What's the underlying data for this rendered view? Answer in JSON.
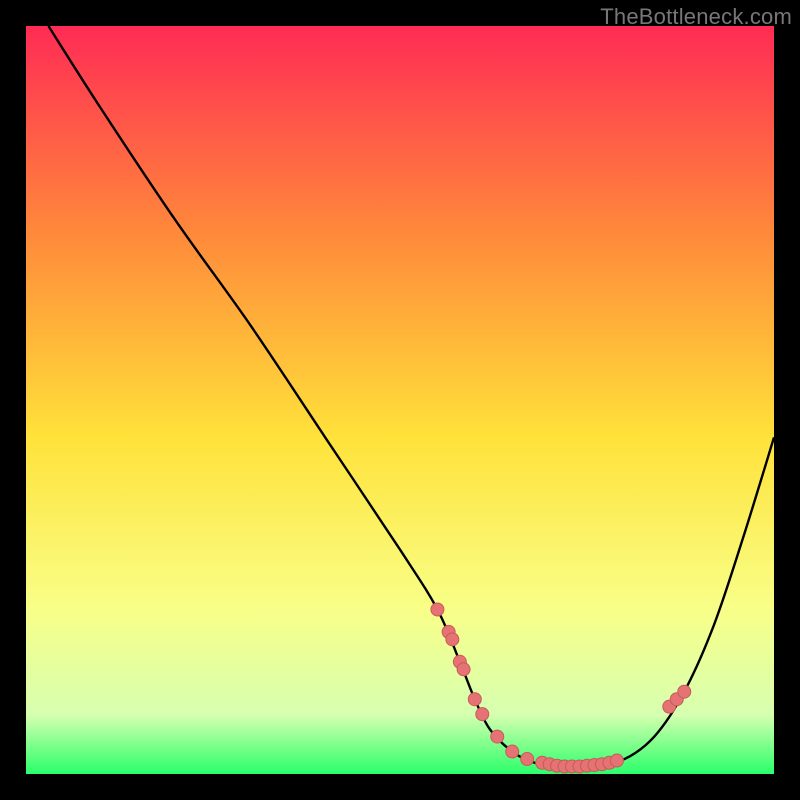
{
  "watermark": "TheBottleneck.com",
  "colors": {
    "gradient_top": "#ff2b55",
    "gradient_mid_upper": "#ff8a3a",
    "gradient_mid": "#ffe23a",
    "gradient_lower": "#f8ff88",
    "gradient_near_bottom": "#d7ffb0",
    "gradient_bottom": "#2aff6a",
    "curve": "#000000",
    "point_fill": "#e57373",
    "point_stroke": "#c85a5a",
    "frame": "#000000"
  },
  "chart_data": {
    "type": "line",
    "title": "",
    "xlabel": "",
    "ylabel": "",
    "xlim": [
      0,
      100
    ],
    "ylim": [
      0,
      100
    ],
    "curve": {
      "name": "bottleneck-curve",
      "x": [
        3,
        10,
        20,
        30,
        40,
        50,
        55,
        58,
        60,
        62,
        65,
        68,
        72,
        76,
        80,
        84,
        88,
        92,
        96,
        100
      ],
      "y": [
        100,
        89,
        74,
        60,
        45,
        30,
        22,
        15,
        10,
        6,
        3,
        1.5,
        1,
        1.2,
        2,
        5,
        11,
        20,
        32,
        45
      ]
    },
    "points": {
      "name": "sample-points",
      "x": [
        55,
        56.5,
        57,
        58,
        58.5,
        60,
        61,
        63,
        65,
        67,
        69,
        70,
        71,
        72,
        73,
        74,
        75,
        76,
        77,
        78,
        79,
        86,
        87,
        88
      ],
      "y": [
        22,
        19,
        18,
        15,
        14,
        10,
        8,
        5,
        3,
        2,
        1.5,
        1.3,
        1.1,
        1.0,
        1.0,
        1.0,
        1.1,
        1.2,
        1.3,
        1.5,
        1.8,
        9,
        10,
        11
      ]
    }
  }
}
